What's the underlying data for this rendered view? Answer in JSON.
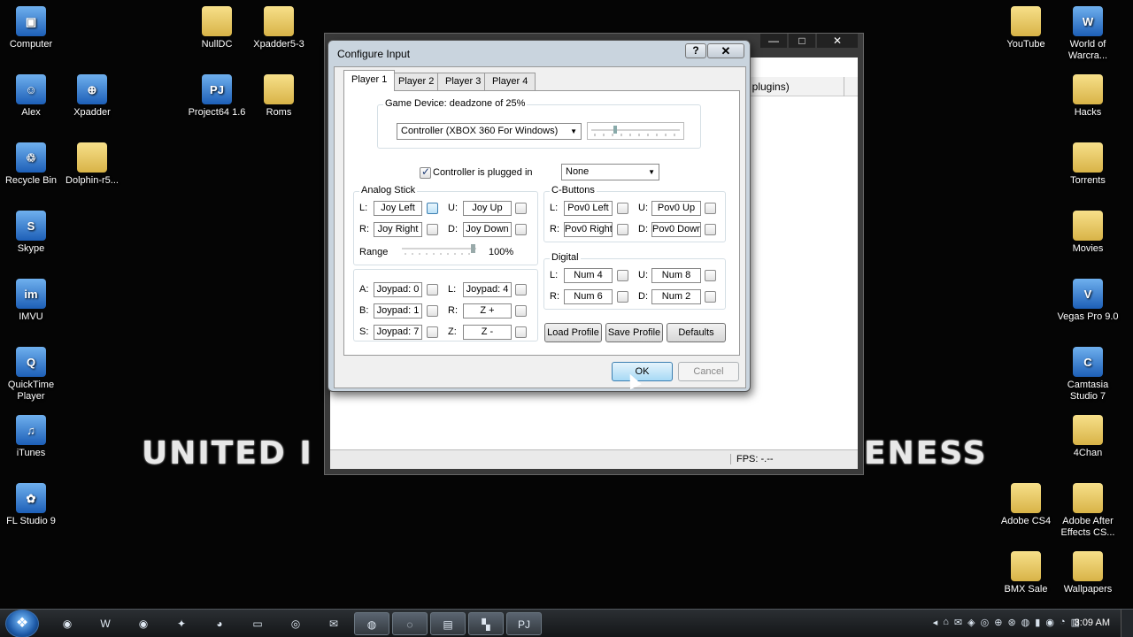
{
  "desktop": {
    "icons_left": [
      {
        "label": "Computer",
        "glyph": "▣",
        "icon": "computer-icon"
      },
      {
        "label": "Alex",
        "glyph": "☺",
        "icon": "user-folder-icon"
      },
      {
        "label": "Recycle Bin",
        "glyph": "♲",
        "icon": "recycle-bin-icon"
      },
      {
        "label": "Skype",
        "glyph": "S",
        "icon": "skype-icon"
      },
      {
        "label": "IMVU",
        "glyph": "im",
        "icon": "imvu-icon"
      },
      {
        "label": "QuickTime\nPlayer",
        "glyph": "Q",
        "icon": "quicktime-icon"
      },
      {
        "label": "iTunes",
        "glyph": "♫",
        "icon": "itunes-icon"
      },
      {
        "label": "FL Studio 9",
        "glyph": "✿",
        "icon": "fl-studio-icon"
      }
    ],
    "icons_col2": [
      {
        "label": "Xpadder",
        "glyph": "⊕",
        "icon": "gamepad-icon"
      },
      {
        "label": "Dolphin-r5...",
        "glyph": "",
        "icon": "folder-icon"
      }
    ],
    "icons_col3": [
      {
        "label": "NullDC",
        "glyph": "",
        "icon": "folder-icon"
      },
      {
        "label": "Project64 1.6",
        "glyph": "PJ",
        "icon": "project64-icon"
      }
    ],
    "icons_col4": [
      {
        "label": "Xpadder5-3",
        "glyph": "",
        "icon": "folder-icon"
      },
      {
        "label": "Roms",
        "glyph": "",
        "icon": "folder-icon"
      }
    ],
    "icons_right_a": [
      {
        "label": "YouTube",
        "glyph": "",
        "icon": "folder-icon"
      },
      {
        "label": "Adobe CS4",
        "glyph": "",
        "icon": "folder-icon"
      },
      {
        "label": "BMX Sale",
        "glyph": "",
        "icon": "folder-icon"
      }
    ],
    "icons_right_b": [
      {
        "label": "World of\nWarcra...",
        "glyph": "W",
        "icon": "wow-icon"
      },
      {
        "label": "Hacks",
        "glyph": "",
        "icon": "folder-icon"
      },
      {
        "label": "Torrents",
        "glyph": "",
        "icon": "folder-icon"
      },
      {
        "label": "Movies",
        "glyph": "",
        "icon": "folder-icon"
      },
      {
        "label": "Vegas Pro 9.0",
        "glyph": "V",
        "icon": "vegas-icon"
      },
      {
        "label": "Camtasia\nStudio 7",
        "glyph": "C",
        "icon": "camtasia-icon"
      },
      {
        "label": "4Chan",
        "glyph": "",
        "icon": "folder-icon"
      },
      {
        "label": "Adobe After\nEffects CS...",
        "glyph": "",
        "icon": "folder-icon"
      },
      {
        "label": "Wallpapers",
        "glyph": "",
        "icon": "folder-icon"
      }
    ],
    "banner_left": "UNITED",
    "banner_left_partial": "I",
    "banner_right": "ENESS"
  },
  "main_window": {
    "btn_min": "—",
    "btn_max": "□",
    "btn_close": "✕",
    "column_header": "t plugins)",
    "fps": "FPS: -.--"
  },
  "dialog": {
    "title": "Configure Input",
    "help": "?",
    "close": "✕",
    "tabs": [
      "Player 1",
      "Player 2",
      "Player 3",
      "Player 4"
    ],
    "game_device_label": "Game Device: deadzone of 25%",
    "device_value": "Controller (XBOX 360 For Windows)",
    "plugged_in_label": "Controller is plugged in",
    "pak_value": "None",
    "analog_label": "Analog Stick",
    "analog": {
      "l_label": "L:",
      "l_value": "Joy Left",
      "u_label": "U:",
      "u_value": "Joy Up",
      "r_label": "R:",
      "r_value": "Joy Right",
      "d_label": "D:",
      "d_value": "Joy Down",
      "range_label": "Range",
      "range_value": "100%"
    },
    "buttons": {
      "a_label": "A:",
      "a_value": "Joypad: 0",
      "l_label": "L:",
      "l_value": "Joypad: 4",
      "b_label": "B:",
      "b_value": "Joypad: 1",
      "r_label": "R:",
      "r_value": "Z +",
      "s_label": "S:",
      "s_value": "Joypad: 7",
      "z_label": "Z:",
      "z_value": "Z -"
    },
    "cbuttons_label": "C-Buttons",
    "cbuttons": {
      "l_label": "L:",
      "l_value": "Pov0 Left",
      "u_label": "U:",
      "u_value": "Pov0 Up",
      "r_label": "R:",
      "r_value": "Pov0 Right",
      "d_label": "D:",
      "d_value": "Pov0 Down"
    },
    "digital_label": "Digital",
    "digital": {
      "l_label": "L:",
      "l_value": "Num 4",
      "u_label": "U:",
      "u_value": "Num 8",
      "r_label": "R:",
      "r_value": "Num 6",
      "d_label": "D:",
      "d_value": "Num 2"
    },
    "load_profile": "Load Profile",
    "save_profile": "Save Profile",
    "defaults": "Defaults",
    "ok": "OK",
    "cancel": "Cancel"
  },
  "taskbar": {
    "start": "❖",
    "items": [
      {
        "glyph": "◉",
        "icon": "browser-icon",
        "running": false
      },
      {
        "glyph": "W",
        "icon": "wow-icon",
        "running": false
      },
      {
        "glyph": "◉",
        "icon": "media-player-icon",
        "running": false
      },
      {
        "glyph": "✦",
        "icon": "app-icon",
        "running": false
      },
      {
        "glyph": "◕",
        "icon": "chrome-icon",
        "running": false
      },
      {
        "glyph": "▭",
        "icon": "explorer-icon",
        "running": false
      },
      {
        "glyph": "◎",
        "icon": "steam-icon",
        "running": false
      },
      {
        "glyph": "✉",
        "icon": "mail-icon",
        "running": false
      },
      {
        "glyph": "◍",
        "icon": "itunes-icon",
        "running": true
      },
      {
        "glyph": "◌",
        "icon": "app-icon",
        "running": true
      },
      {
        "glyph": "▤",
        "icon": "camtasia-icon",
        "running": true
      },
      {
        "glyph": "▚",
        "icon": "xpadder-icon",
        "running": true
      },
      {
        "glyph": "PJ",
        "icon": "project64-icon",
        "running": true
      }
    ],
    "tray": [
      "◂",
      "⌂",
      "✉",
      "◈",
      "◎",
      "⊕",
      "⊛",
      "◍",
      "▮",
      "◉",
      "◔",
      "▥"
    ],
    "clock": "3:09 AM"
  }
}
